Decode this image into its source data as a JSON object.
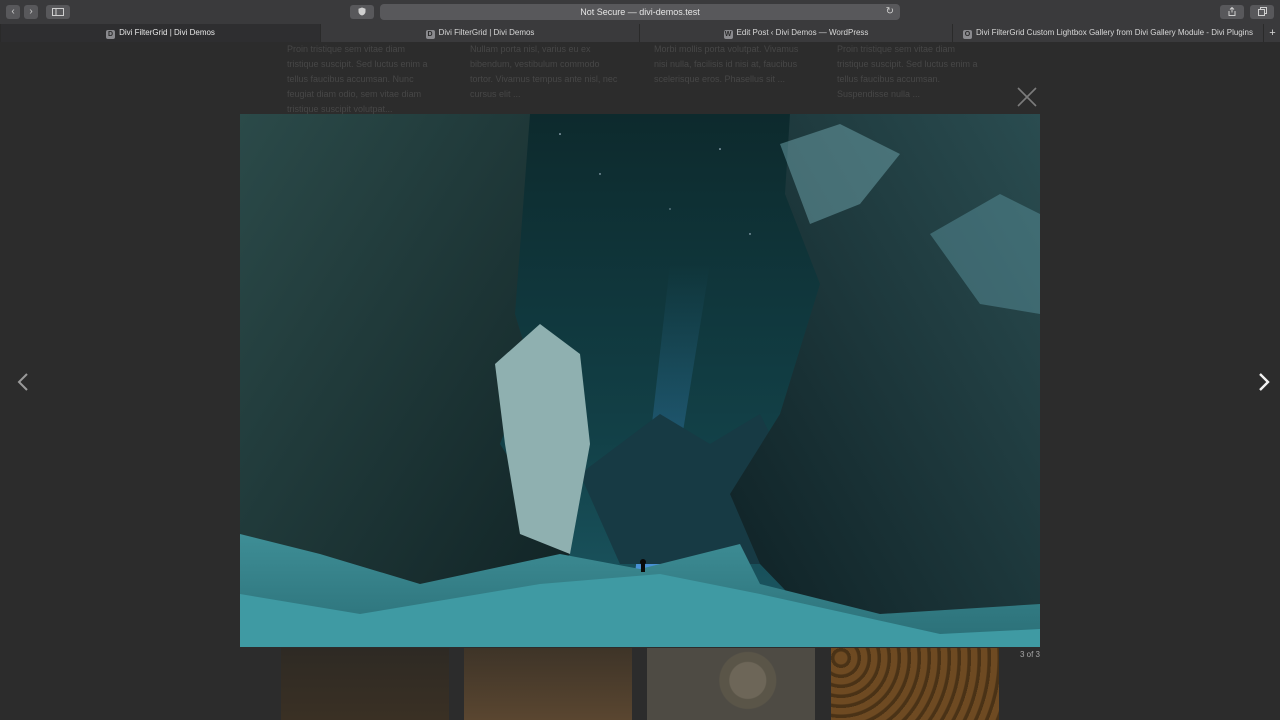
{
  "browser": {
    "address": "Not Secure — divi-demos.test",
    "tabs": [
      {
        "label": "Divi FilterGrid | Divi Demos",
        "favicon": "D"
      },
      {
        "label": "Divi FilterGrid | Divi Demos",
        "favicon": "D"
      },
      {
        "label": "Edit Post ‹ Divi Demos — WordPress",
        "favicon": "W"
      },
      {
        "label": "Divi FilterGrid Custom Lightbox Gallery from Divi Gallery Module - Divi Plugins",
        "favicon": "O"
      }
    ]
  },
  "background_cards": [
    {
      "text": "Proin tristique sem vitae diam tristique suscipit. Sed luctus enim a tellus faucibus accumsan. Nunc feugiat diam odio, sem vitae diam tristique suscipit volutpat..."
    },
    {
      "text": "Nullam porta nisl, varius eu ex bibendum, vestibulum commodo tortor. Vivamus tempus ante nisl, nec cursus elit ..."
    },
    {
      "text": "Morbi mollis porta volutpat. Vivamus nisi nulla, facilisis id nisi at, faucibus scelerisque eros. Phasellus sit ..."
    },
    {
      "text": "Proin tristique sem vitae diam tristique suscipit. Sed luctus enim a tellus faucibus accumsan. Suspendisse nulla ..."
    }
  ],
  "lightbox": {
    "counter": "3 of 3",
    "icons": {
      "close": "close-icon",
      "prev": "chevron-left-icon",
      "next": "chevron-right-icon"
    }
  },
  "colors": {
    "overlay": "#2b2b2b",
    "chrome": "#3a3a3c"
  }
}
